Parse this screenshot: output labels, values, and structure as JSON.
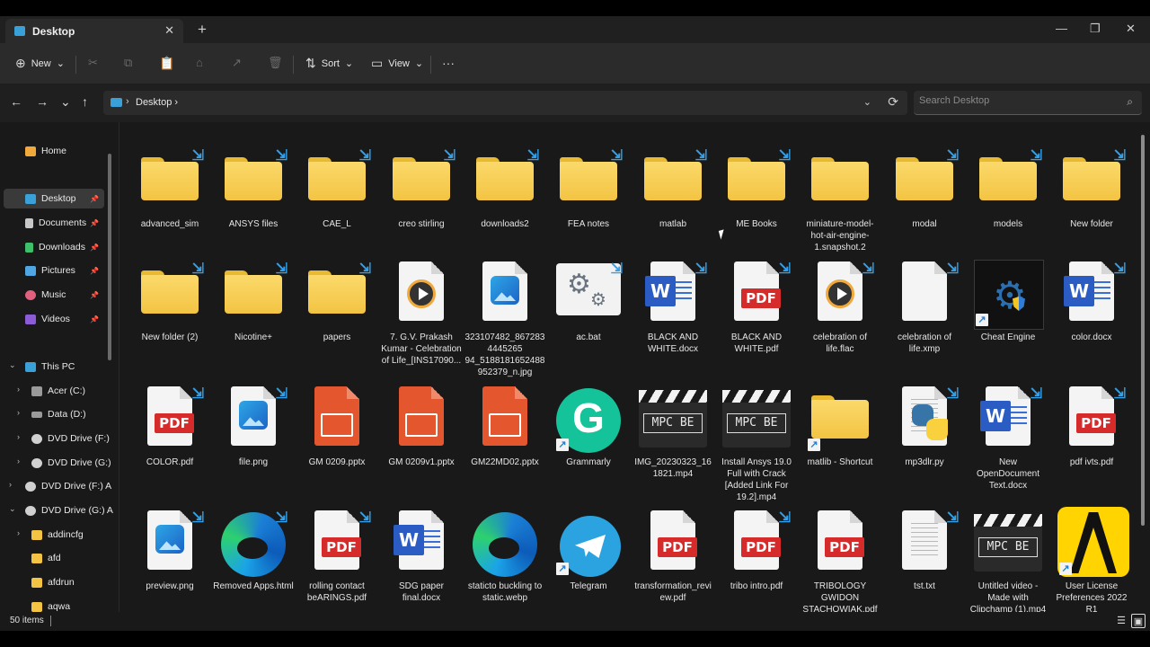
{
  "window": {
    "tab_label": "Desktop",
    "tab_close": "✕",
    "new_tab": "+",
    "minimize": "—",
    "restore": "❐",
    "close": "✕"
  },
  "toolbar": {
    "new_label": "New",
    "new_icon": "⊕",
    "sort_label": "Sort",
    "sort_icon": "⇅",
    "view_label": "View",
    "view_icon": "▭",
    "more": "···",
    "cut": "✂",
    "copy": "⧉",
    "paste": "📋",
    "rename": "⌂",
    "share": "↗",
    "delete": "🗑",
    "caret": "⌄"
  },
  "nav": {
    "back": "←",
    "forward": "→",
    "recent": "⌄",
    "up": "↑",
    "breadcrumb": "Desktop",
    "crumb_sep": "›",
    "dropdown": "⌄",
    "refresh": "⟳",
    "search_placeholder": "Search Desktop",
    "search_icon": "⌕"
  },
  "sidebar": {
    "home": "Home",
    "desktop": "Desktop",
    "documents": "Documents",
    "downloads": "Downloads",
    "pictures": "Pictures",
    "music": "Music",
    "videos": "Videos",
    "this_pc": "This PC",
    "acer": "Acer (C:)",
    "data": "Data (D:)",
    "dvd_f": "DVD Drive (F:)",
    "dvd_g": "DVD Drive (G:)",
    "dvd_f2": "DVD Drive (F:) A",
    "dvd_g2": "DVD Drive (G:) A",
    "addincfg": "addincfg",
    "afd": "afd",
    "afdrun": "afdrun",
    "aqwa": "aqwa",
    "pin": "📌",
    "chev_right": "›",
    "chev_down": "⌄"
  },
  "files": [
    {
      "name": "advanced_sim"
    },
    {
      "name": "ANSYS files"
    },
    {
      "name": "CAE_L"
    },
    {
      "name": "creo stirling"
    },
    {
      "name": "downloads2"
    },
    {
      "name": "FEA notes"
    },
    {
      "name": "matlab"
    },
    {
      "name": "ME Books"
    },
    {
      "name": "miniature-model-hot-air-engine-1.snapshot.2"
    },
    {
      "name": "modal"
    },
    {
      "name": "models"
    },
    {
      "name": "New folder"
    },
    {
      "name": "New folder (2)"
    },
    {
      "name": "Nicotine+"
    },
    {
      "name": "papers"
    },
    {
      "name": "7. G.V. Prakash Kumar - Celebration of Life_[INS17090..."
    },
    {
      "name": "323107482_8672834445265 94_5188181652488952379_n.jpg"
    },
    {
      "name": "ac.bat"
    },
    {
      "name": "BLACK AND WHITE.docx"
    },
    {
      "name": "BLACK AND WHITE.pdf"
    },
    {
      "name": "celebration of life.flac"
    },
    {
      "name": "celebration of life.xmp"
    },
    {
      "name": "Cheat Engine"
    },
    {
      "name": "color.docx"
    },
    {
      "name": "COLOR.pdf"
    },
    {
      "name": "file.png"
    },
    {
      "name": "GM 0209.pptx"
    },
    {
      "name": "GM 0209v1.pptx"
    },
    {
      "name": "GM22MD02.pptx"
    },
    {
      "name": "Grammarly"
    },
    {
      "name": "IMG_20230323_161821.mp4"
    },
    {
      "name": "Install Ansys 19.0 Full with Crack [Added Link For 19.2].mp4"
    },
    {
      "name": "matlib - Shortcut"
    },
    {
      "name": "mp3dlr.py"
    },
    {
      "name": "New OpenDocument Text.docx"
    },
    {
      "name": "pdf ivts.pdf"
    },
    {
      "name": "preview.png"
    },
    {
      "name": "Removed Apps.html"
    },
    {
      "name": "rolling contact beARINGS.pdf"
    },
    {
      "name": "SDG paper final.docx"
    },
    {
      "name": "staticto buckling to static.webp"
    },
    {
      "name": "Telegram"
    },
    {
      "name": "transformation_review.pdf"
    },
    {
      "name": "tribo intro.pdf"
    },
    {
      "name": "TRIBOLOGY GWIDON STACHOWIAK.pdf"
    },
    {
      "name": "tst.txt"
    },
    {
      "name": "Untitled video - Made with Clipchamp (1).mp4"
    },
    {
      "name": "User License Preferences 2022 R1"
    }
  ],
  "icon_text": {
    "pdf": "PDF",
    "word": "W",
    "mpc": "MPC BE",
    "sync": "⇲",
    "shortcut": "↗",
    "gear_big": "⚙",
    "gear_small": "⚙"
  },
  "status": {
    "count": "50 items",
    "details_view": "☰",
    "tiles_view": "▣"
  },
  "colors": {
    "accent": "#3aa0d8",
    "folder": "#f3c443",
    "pdf": "#d62b2b",
    "word": "#2b5cc4",
    "pptx": "#e4572e"
  }
}
